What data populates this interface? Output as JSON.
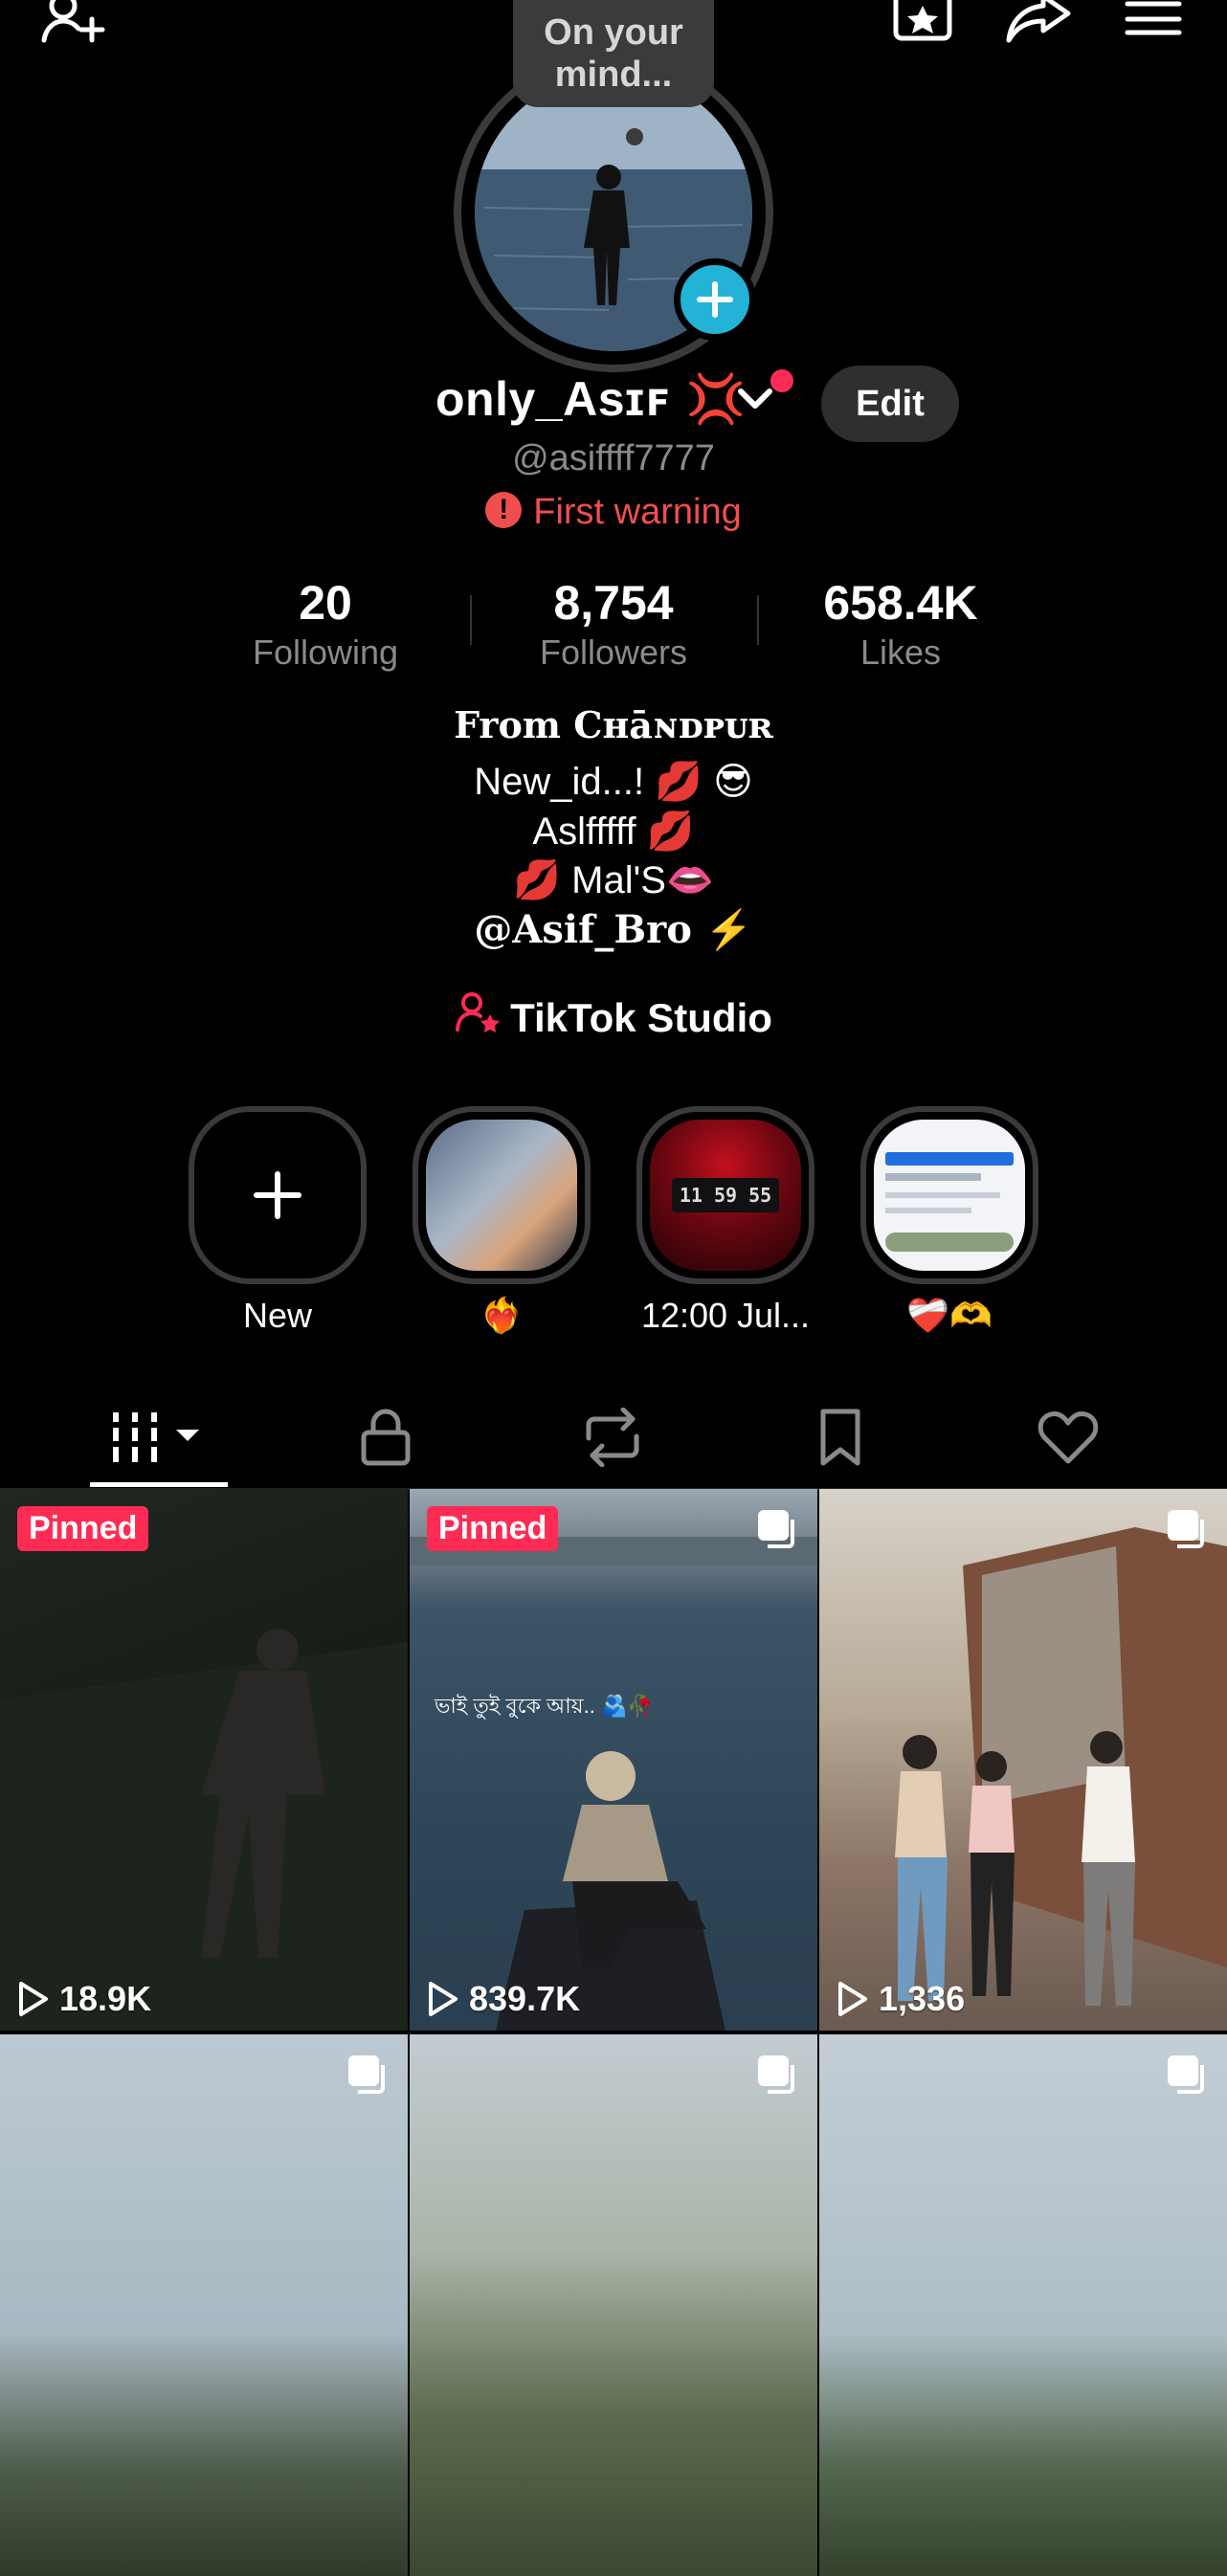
{
  "top_bar": {
    "add_friend_icon": "person-plus-icon",
    "favorites_icon": "star-bookmark-icon",
    "share_icon": "share-arrow-icon",
    "menu_icon": "hamburger-menu-icon"
  },
  "profile": {
    "mind_bubble": "On your mind...",
    "display_name": "only_Asɪꜰ 💢",
    "edit_label": "Edit",
    "handle": "@asiffff7777",
    "warning": "First warning",
    "colors": {
      "accent": "#fe2c55",
      "story_add": "#22b3d6",
      "warning": "#f04e4e"
    }
  },
  "stats": [
    {
      "value": "20",
      "label": "Following"
    },
    {
      "value": "8,754",
      "label": "Followers"
    },
    {
      "value": "658.4K",
      "label": "Likes"
    }
  ],
  "bio": {
    "line1": "From Cʜāɴᴅᴘᴜʀ",
    "line2": "New_id...! 💋 😎",
    "line3": "Aslfffff 💋",
    "line4": "💋 Mal'S👄",
    "line5": "@Asif_Bro ⚡"
  },
  "studio": {
    "label": "TikTok Studio",
    "icon": "creator-star-icon"
  },
  "highlights": [
    {
      "label": "New"
    },
    {
      "label": "❤️‍🔥"
    },
    {
      "label": "12:00 Jul..."
    },
    {
      "label": "❤️‍🩹🫶"
    }
  ],
  "highlight_clock_text": "11 59 55",
  "tabs": [
    "videos-grid",
    "private",
    "reposts",
    "favorites",
    "liked"
  ],
  "videos": [
    {
      "pinned": "Pinned",
      "views": "18.9K"
    },
    {
      "pinned": "Pinned",
      "views": "839.7K",
      "caption": "ভাই তুই বুকে আয়.. 🫂🥀"
    },
    {
      "views": "1,336"
    },
    {
      "views": ""
    },
    {
      "views": ""
    },
    {
      "views": ""
    }
  ]
}
